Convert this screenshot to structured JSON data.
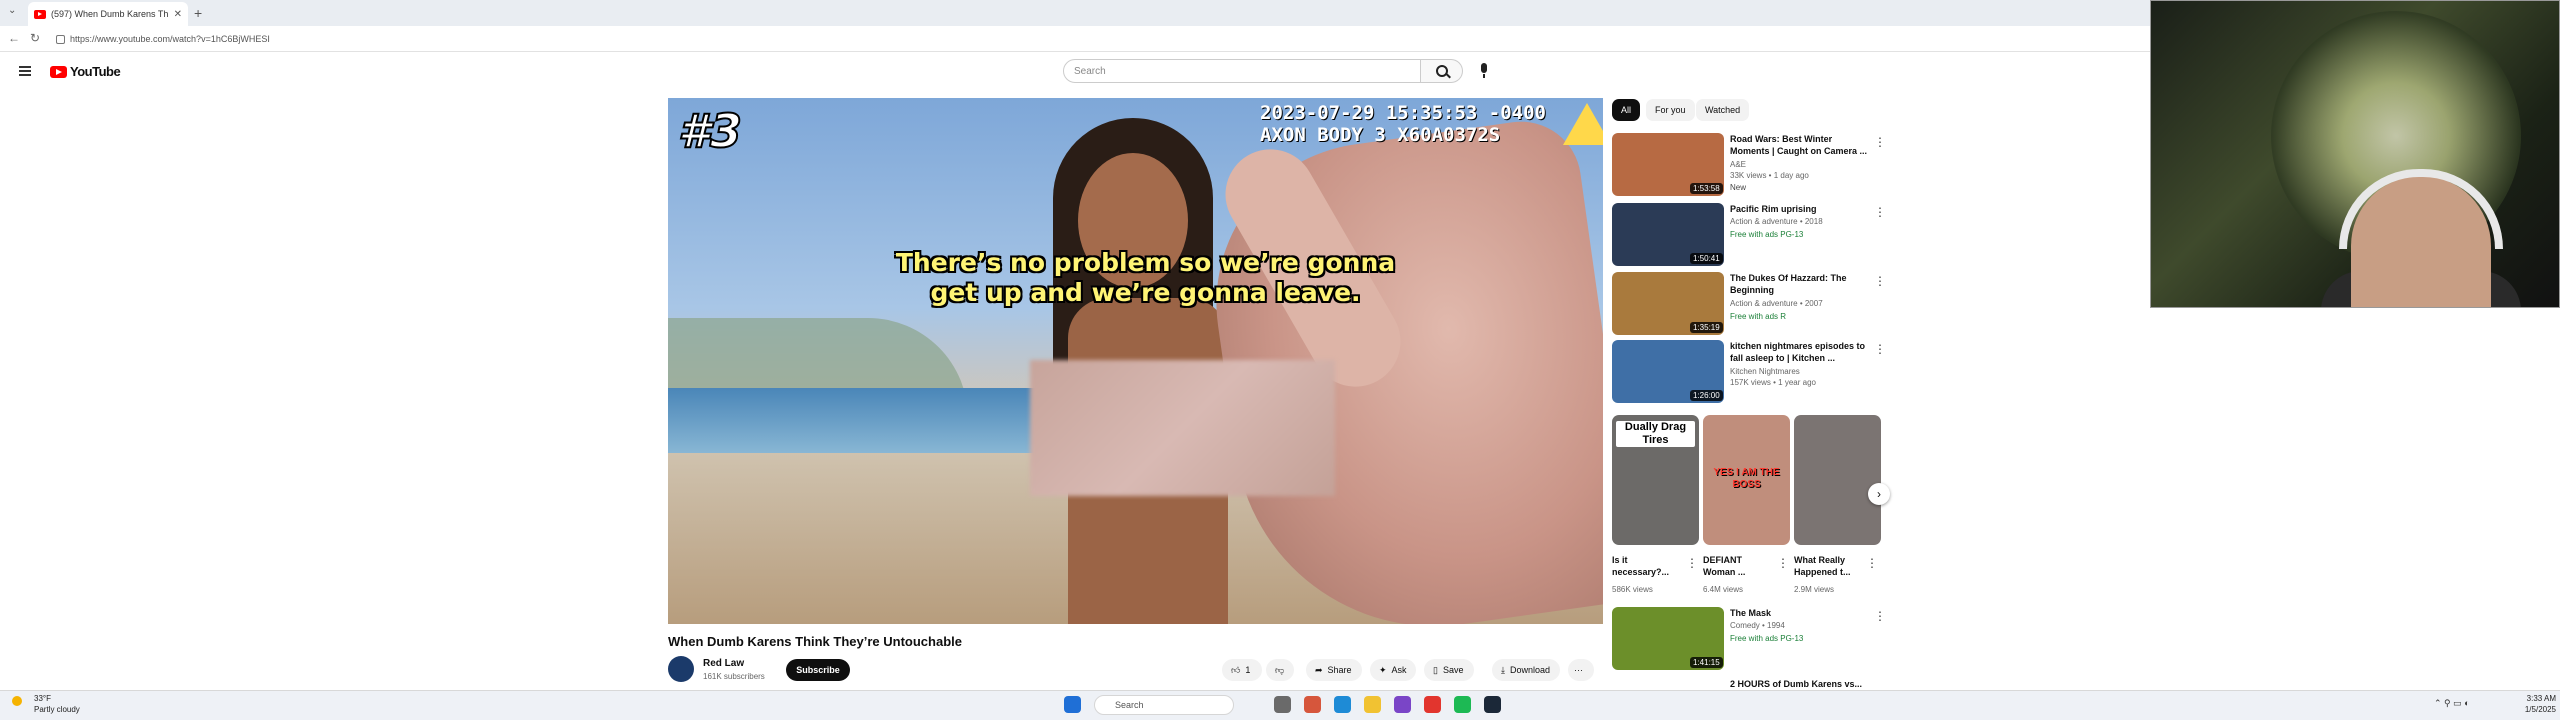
{
  "browser": {
    "tab_title": "(597) When Dumb Karens Th",
    "url": "https://www.youtube.com/watch?v=1hC6BjWHESI",
    "new_tab": "+",
    "tab_close": "✕"
  },
  "youtube": {
    "logo": "YouTube",
    "search_placeholder": "Search"
  },
  "video": {
    "badge": "#3",
    "timestamp_line1": "2023-07-29 15:35:53 -0400",
    "timestamp_line2": "AXON BODY 3 X60A0372S",
    "subtitle_line1": "There’s no problem so we’re gonna",
    "subtitle_line2": "get up and we’re gonna leave.",
    "title": "When Dumb Karens Think They’re Untouchable",
    "channel": "Red Law",
    "subscribers": "161K subscribers",
    "subscribe_label": "Subscribe",
    "like_count": "1",
    "share_label": "Share",
    "ask_label": "Ask",
    "save_label": "Save",
    "download_label": "Download",
    "more_label": "···"
  },
  "chips": [
    "All",
    "For you",
    "Watched"
  ],
  "recommendations": [
    {
      "title": "Road Wars: Best Winter Moments | Caught on Camera ...",
      "meta1": "A&E",
      "meta2": "33K views • 1 day ago",
      "tag": "New",
      "duration": "1:53:58",
      "color": "#b76a43"
    },
    {
      "title": "Pacific Rim uprising",
      "meta1": "Action & adventure • 2018",
      "meta2": "",
      "tag": "Free with ads   PG-13",
      "duration": "1:50:41",
      "color": "#2b3b56"
    },
    {
      "title": "The Dukes Of Hazzard: The Beginning",
      "meta1": "Action & adventure • 2007",
      "meta2": "",
      "tag": "Free with ads   R",
      "duration": "1:35:19",
      "color": "#a97a3d"
    },
    {
      "title": "kitchen nightmares episodes to fall asleep to | Kitchen ...",
      "meta1": "Kitchen Nightmares",
      "meta2": "157K views • 1 year ago",
      "tag": "",
      "duration": "1:26:00",
      "color": "#3f6fa6"
    }
  ],
  "shorts": [
    {
      "title": "Is it necessary?...",
      "views": "586K views",
      "caption": "Dually Drag Tires",
      "color": "#6c6a68"
    },
    {
      "title": "DEFIANT Woman ...",
      "views": "6.4M views",
      "caption": "YES I AM THE BOSS",
      "color": "#c08e7c"
    },
    {
      "title": "What Really Happened t...",
      "views": "2.9M views",
      "caption": "",
      "color": "#7b7472"
    }
  ],
  "recommendation_after": {
    "title": "The Mask",
    "meta1": "Comedy • 1994",
    "tag": "Free with ads   PG-13",
    "duration": "1:41:15",
    "color": "#6c8f2a",
    "next_title": "2 HOURS of Dumb Karens vs..."
  },
  "taskbar": {
    "weather_temp": "33°F",
    "weather_desc": "Partly cloudy",
    "search": "Search",
    "time": "3:33 AM",
    "date": "1/5/2025"
  }
}
